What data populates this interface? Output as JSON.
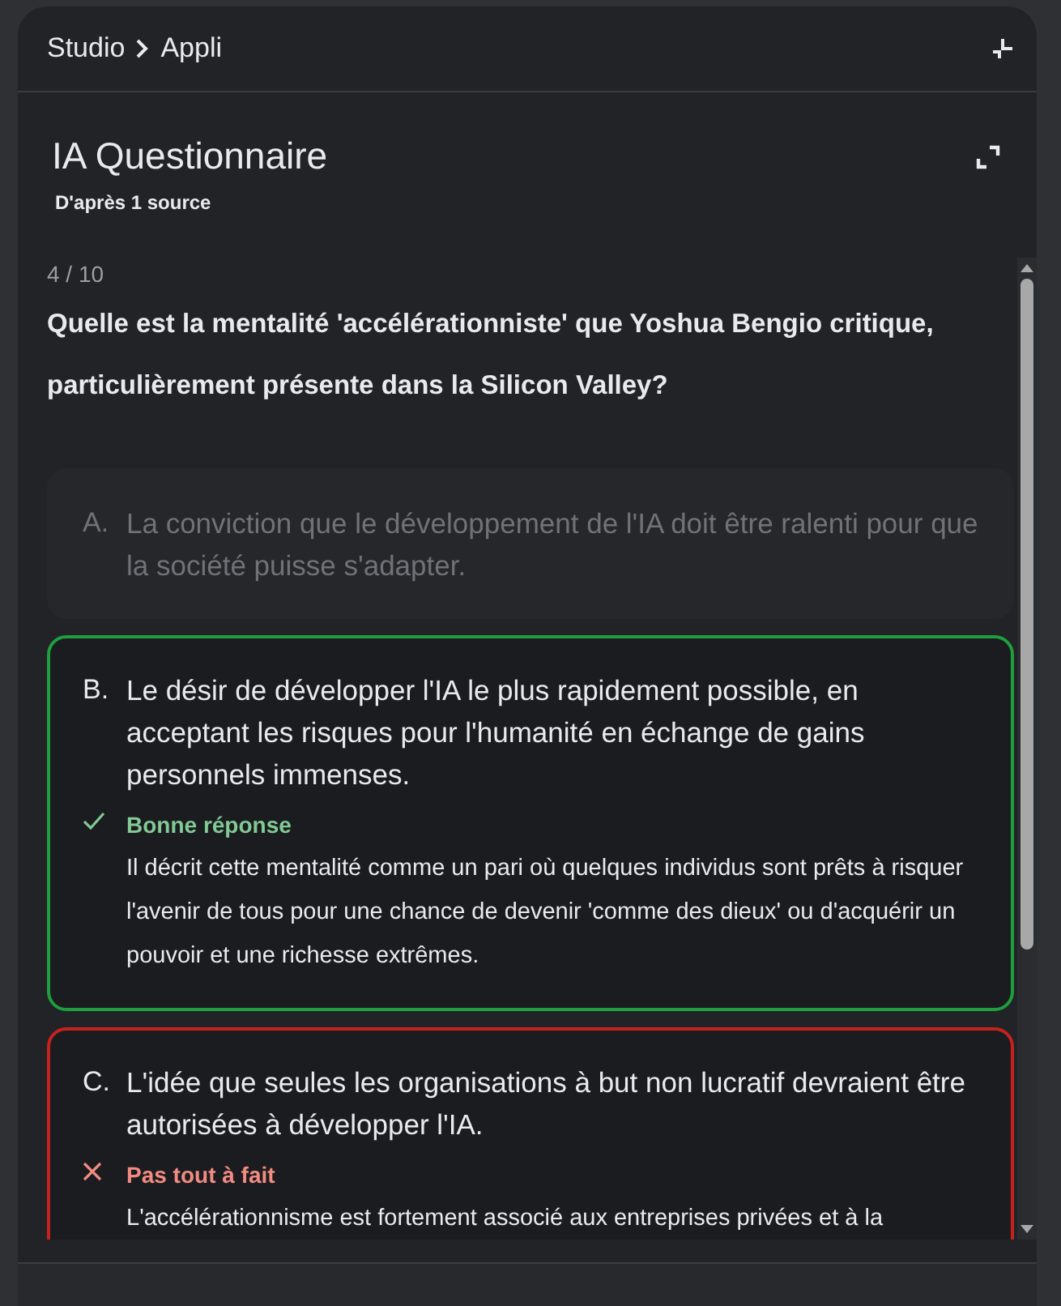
{
  "breadcrumb": [
    "Studio",
    "Appli"
  ],
  "header": {
    "title": "IA Questionnaire",
    "subtitle": "D'après 1 source"
  },
  "quiz": {
    "counter": "4 / 10",
    "question": "Quelle est la mentalité 'accélérationniste' que Yoshua Bengio critique, particulièrement présente dans la Silicon Valley?",
    "options": [
      {
        "letter": "A.",
        "text": "La conviction que le développement de l'IA doit être ralenti pour que la société puisse s'adapter.",
        "kind": "dimmed"
      },
      {
        "letter": "B.",
        "text": "Le désir de développer l'IA le plus rapidement possible, en acceptant les risques pour l'humanité en échange de gains personnels immenses.",
        "kind": "correct",
        "verdict": "Bonne réponse",
        "explanation": "Il décrit cette mentalité comme un pari où quelques individus sont prêts à risquer l'avenir de tous pour une chance de devenir 'comme des dieux' ou d'acquérir un pouvoir et une richesse extrêmes."
      },
      {
        "letter": "C.",
        "text": "L'idée que seules les organisations à but non lucratif devraient être autorisées à développer l'IA.",
        "kind": "incorrect",
        "verdict": "Pas tout à fait",
        "explanation": "L'accélérationnisme est fortement associé aux entreprises privées et à la"
      }
    ]
  }
}
